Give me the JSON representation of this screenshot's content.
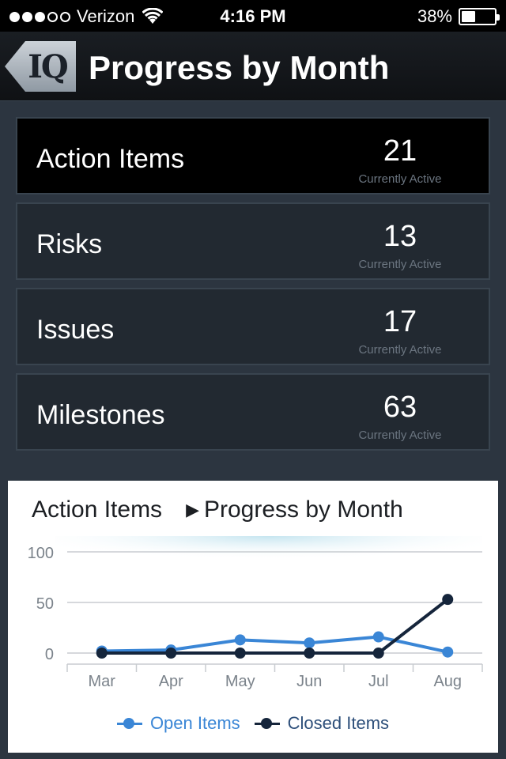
{
  "status_bar": {
    "carrier": "Verizon",
    "time": "4:16 PM",
    "battery": "38%",
    "battery_level": 0.38,
    "signal_bars_filled": 3,
    "signal_bars_total": 5
  },
  "nav": {
    "back_logo": "IQ",
    "title": "Progress by Month"
  },
  "cards": [
    {
      "label": "Action Items",
      "value": "21",
      "sub": "Currently Active"
    },
    {
      "label": "Risks",
      "value": "13",
      "sub": "Currently Active"
    },
    {
      "label": "Issues",
      "value": "17",
      "sub": "Currently Active"
    },
    {
      "label": "Milestones",
      "value": "63",
      "sub": "Currently Active"
    }
  ],
  "chart_header": {
    "left": "Action Items",
    "right": "Progress by Month"
  },
  "colors": {
    "open": "#3a86d6",
    "closed": "#15253b"
  },
  "chart_data": {
    "type": "line",
    "categories": [
      "Mar",
      "Apr",
      "May",
      "Jun",
      "Jul",
      "Aug"
    ],
    "yticks": [
      0,
      50,
      100
    ],
    "ylim": [
      0,
      100
    ],
    "grid": true,
    "legend_position": "bottom",
    "series": [
      {
        "name": "Open Items",
        "values": [
          2,
          3,
          13,
          10,
          16,
          1
        ]
      },
      {
        "name": "Closed Items",
        "values": [
          0,
          0,
          0,
          0,
          0,
          53
        ]
      }
    ]
  }
}
